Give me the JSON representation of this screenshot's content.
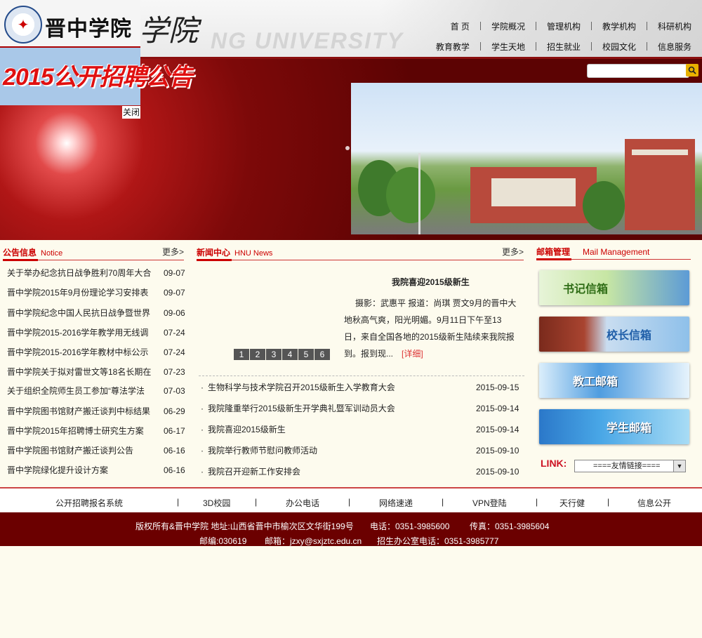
{
  "header": {
    "school_name": "晋中学院",
    "calligraphy": "学院",
    "watermark": "NG UNIVERSITY",
    "nav_row1": [
      "首 页",
      "学院概况",
      "管理机构",
      "教学机构",
      "科研机构"
    ],
    "nav_row2": [
      "教育教学",
      "学生天地",
      "招生就业",
      "校园文化",
      "信息服务"
    ]
  },
  "popup": {
    "title": "2015公开招聘公告",
    "close_label": "关闭"
  },
  "notice": {
    "title": "公告信息",
    "subtitle": "Notice",
    "more": "更多>",
    "items": [
      {
        "title": "关于举办纪念抗日战争胜利70周年大合",
        "date": "09-07"
      },
      {
        "title": "晋中学院2015年9月份理论学习安排表",
        "date": "09-07"
      },
      {
        "title": "晋中学院纪念中国人民抗日战争暨世界",
        "date": "09-06"
      },
      {
        "title": "晋中学院2015-2016学年教学用无线调",
        "date": "07-24"
      },
      {
        "title": "晋中学院2015-2016学年教材中标公示",
        "date": "07-24"
      },
      {
        "title": "晋中学院关于拟对雷世文等18名长期在",
        "date": "07-23"
      },
      {
        "title": "关于组织全院师生员工参加“尊法学法",
        "date": "07-03"
      },
      {
        "title": "晋中学院图书馆财产搬迁谈判中标结果",
        "date": "06-29"
      },
      {
        "title": "晋中学院2015年招聘博士研究生方案",
        "date": "06-17"
      },
      {
        "title": "晋中学院图书馆财产搬迁谈判公告",
        "date": "06-16"
      },
      {
        "title": "晋中学院绿化提升设计方案",
        "date": "06-16"
      }
    ]
  },
  "news": {
    "title": "新闻中心",
    "subtitle": "HNU News",
    "more": "更多>",
    "featured": {
      "headline": "我院喜迎2015级新生",
      "line1": "摄影：武惠平 报道：尚琪 贾文9月的晋中大",
      "line2": "地秋高气爽，阳光明媚。9月11日下午至13",
      "line3": "日，来自全国各地的2015级新生陆续来我院报",
      "line4": "到。报到现...",
      "detail": "[详细]"
    },
    "pages": [
      "1",
      "2",
      "3",
      "4",
      "5",
      "6"
    ],
    "items": [
      {
        "title": "生物科学与技术学院召开2015级新生入学教育大会",
        "date": "2015-09-15"
      },
      {
        "title": "我院隆重举行2015级新生开学典礼暨军训动员大会",
        "date": "2015-09-14"
      },
      {
        "title": "我院喜迎2015级新生",
        "date": "2015-09-14"
      },
      {
        "title": "我院举行教师节慰问教师活动",
        "date": "2015-09-10"
      },
      {
        "title": "我院召开迎新工作安排会",
        "date": "2015-09-10"
      }
    ]
  },
  "mail": {
    "title": "邮箱管理",
    "subtitle": "Mail Management",
    "buttons": [
      "书记信箱",
      "校长信箱",
      "教工邮箱",
      "学生邮箱"
    ],
    "link_label": "LINK:",
    "link_select": "====友情链接===="
  },
  "footer_links": [
    "公开招聘报名系统",
    "3D校园",
    "办公电话",
    "网络速递",
    "VPN登陆",
    "天行健",
    "信息公开"
  ],
  "footer": {
    "copyright": "版权所有&晋中学院 地址:山西省晋中市榆次区文华街199号",
    "phone": "电话：0351-3985600",
    "fax": "传真：0351-3985604",
    "postcode": "邮编:030619",
    "email": "邮箱：jzxy@sxjztc.edu.cn",
    "admission": "招生办公室电话：0351-3985777"
  },
  "colors": {
    "brand_red": "#8b0f0f",
    "accent_red": "#cc0000",
    "footer_bg": "#6b0000"
  }
}
